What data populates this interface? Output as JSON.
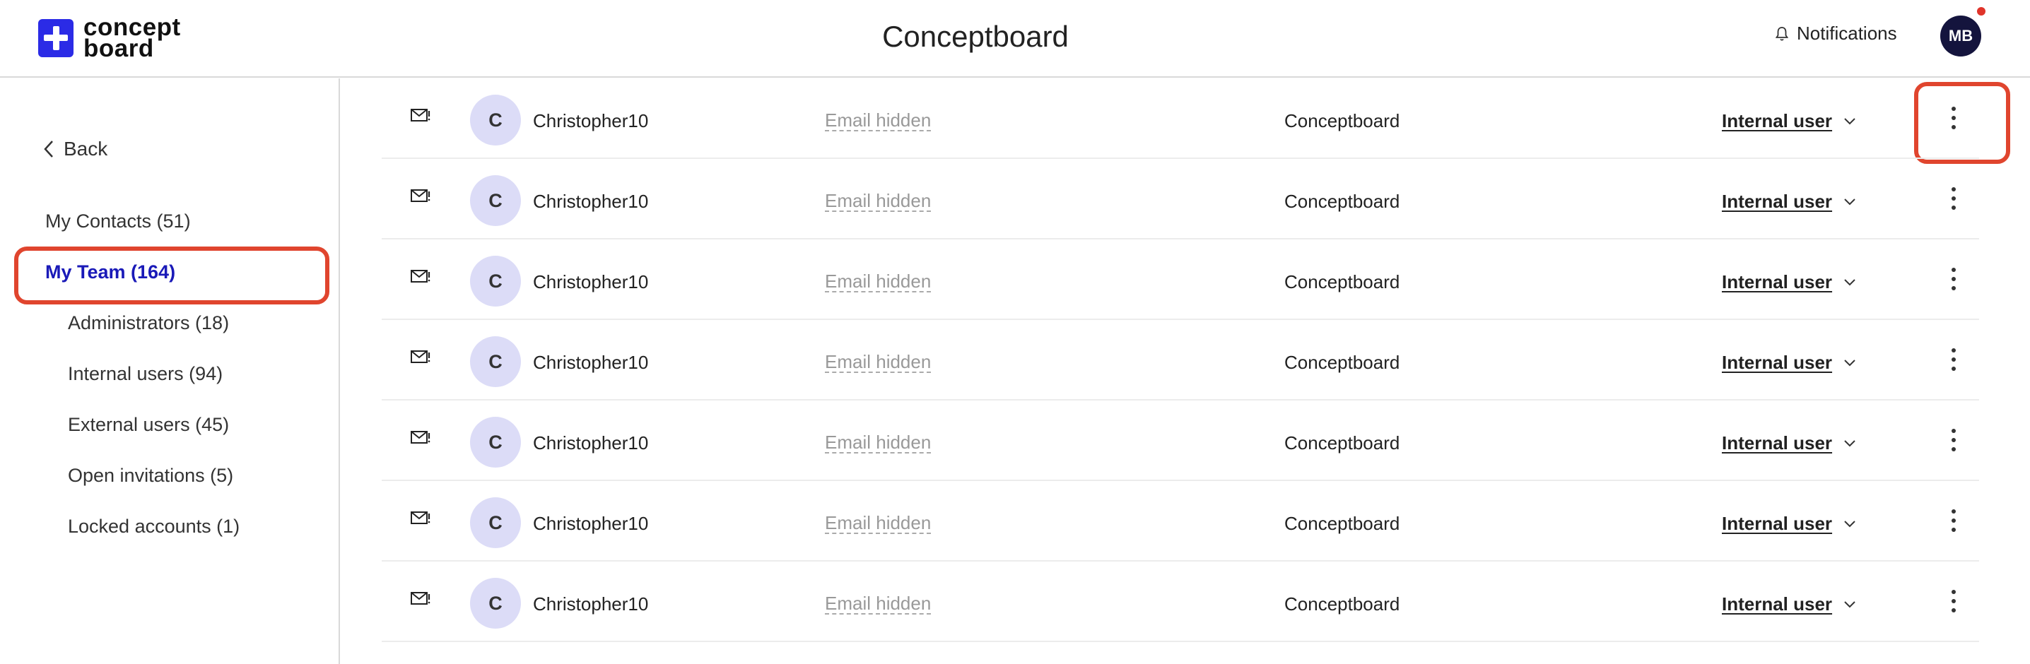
{
  "header": {
    "logo_line1": "concept",
    "logo_line2": "board",
    "title": "Conceptboard",
    "notifications_label": "Notifications",
    "avatar_initials": "MB"
  },
  "sidebar": {
    "back_label": "Back",
    "items": [
      {
        "label": "My Contacts (51)"
      },
      {
        "label": "My Team (164)"
      },
      {
        "label": "Administrators (18)"
      },
      {
        "label": "Internal users (94)"
      },
      {
        "label": "External users (45)"
      },
      {
        "label": "Open invitations (5)"
      },
      {
        "label": "Locked accounts (1)"
      }
    ]
  },
  "colors": {
    "brand": "#2b2be6",
    "active_nav": "#1a1ab8",
    "highlight": "#e0452e",
    "avatar_bg": "#14143d",
    "row_avatar_bg": "#dcdcf7"
  },
  "rows": [
    {
      "initial": "C",
      "name": "Christopher10",
      "email": "Email hidden",
      "company": "Conceptboard",
      "role": "Internal user"
    },
    {
      "initial": "C",
      "name": "Christopher10",
      "email": "Email hidden",
      "company": "Conceptboard",
      "role": "Internal user"
    },
    {
      "initial": "C",
      "name": "Christopher10",
      "email": "Email hidden",
      "company": "Conceptboard",
      "role": "Internal user"
    },
    {
      "initial": "C",
      "name": "Christopher10",
      "email": "Email hidden",
      "company": "Conceptboard",
      "role": "Internal user"
    },
    {
      "initial": "C",
      "name": "Christopher10",
      "email": "Email hidden",
      "company": "Conceptboard",
      "role": "Internal user"
    },
    {
      "initial": "C",
      "name": "Christopher10",
      "email": "Email hidden",
      "company": "Conceptboard",
      "role": "Internal user"
    },
    {
      "initial": "C",
      "name": "Christopher10",
      "email": "Email hidden",
      "company": "Conceptboard",
      "role": "Internal user"
    }
  ]
}
